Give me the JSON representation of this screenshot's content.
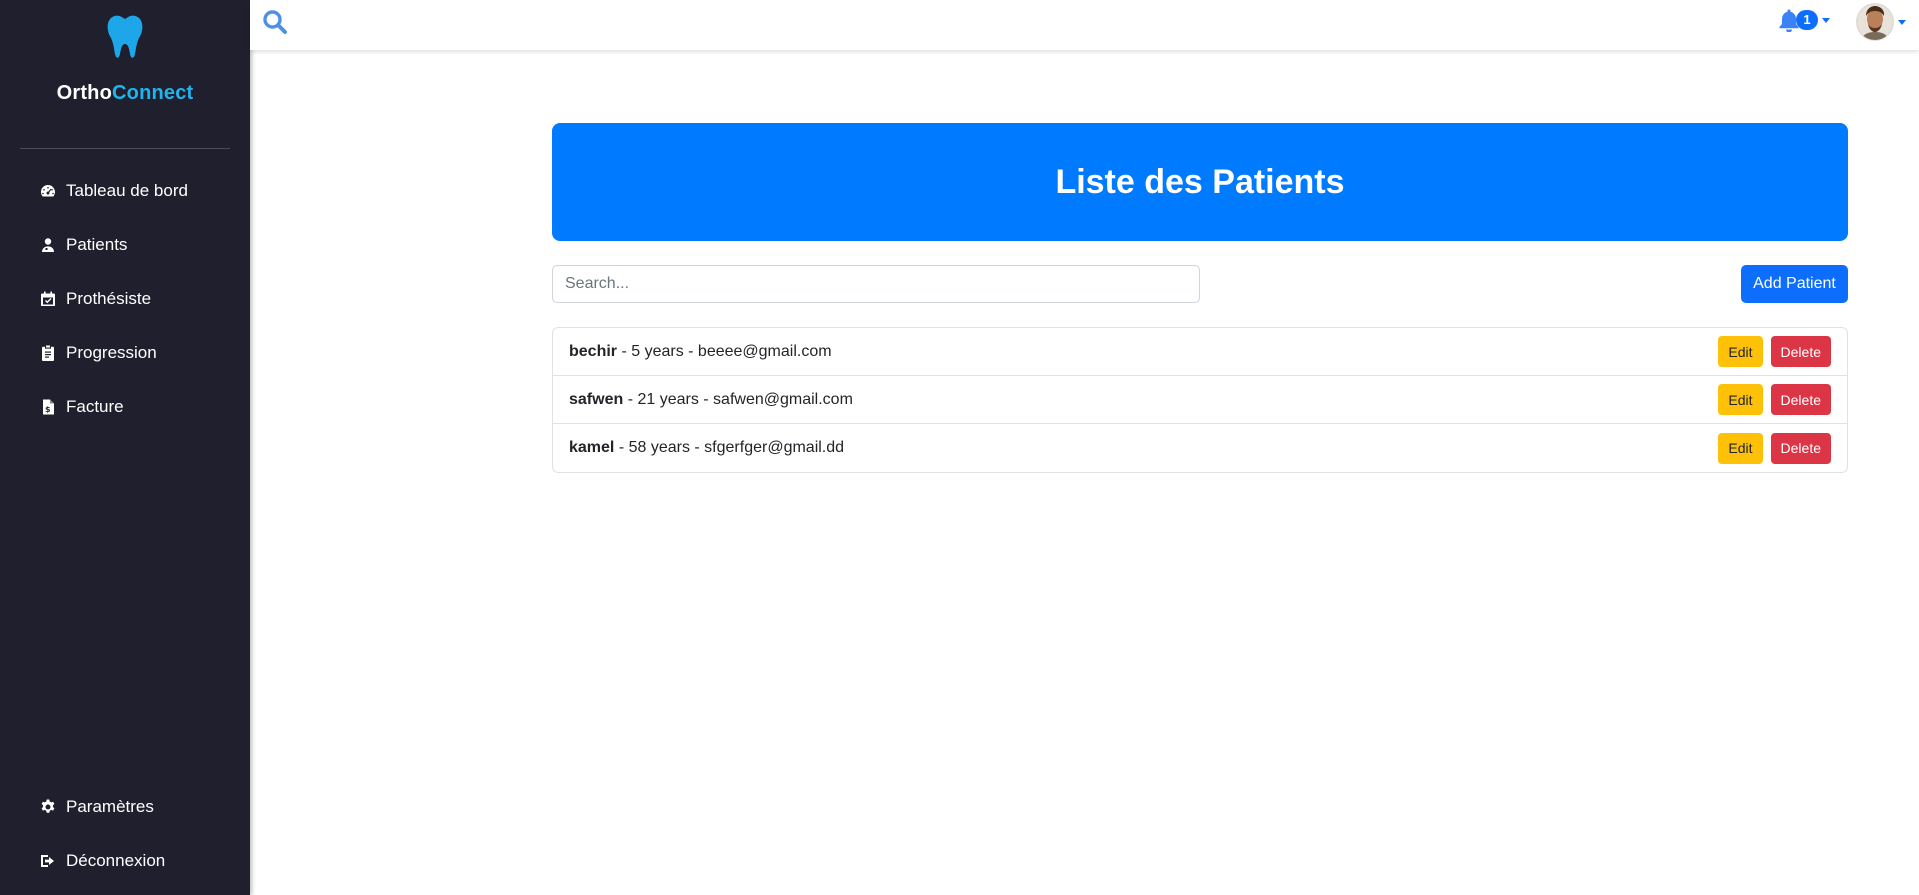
{
  "brand": {
    "part1": "Ortho",
    "part2": "Connect"
  },
  "sidebar": {
    "items": [
      {
        "label": "Tableau de bord",
        "icon": "tachometer-icon"
      },
      {
        "label": "Patients",
        "icon": "user-doctor-icon"
      },
      {
        "label": "Prothésiste",
        "icon": "calendar-check-icon"
      },
      {
        "label": "Progression",
        "icon": "clipboard-icon"
      },
      {
        "label": "Facture",
        "icon": "invoice-icon"
      }
    ],
    "bottom_items": [
      {
        "label": "Paramètres",
        "icon": "gear-icon"
      },
      {
        "label": "Déconnexion",
        "icon": "sign-out-icon"
      }
    ]
  },
  "topbar": {
    "notification_count": "1"
  },
  "main": {
    "title": "Liste des Patients",
    "search_placeholder": "Search...",
    "add_button": "Add Patient",
    "patients": [
      {
        "name": "bechir",
        "details": " - 5 years - beeee@gmail.com"
      },
      {
        "name": "safwen",
        "details": " - 21 years - safwen@gmail.com"
      },
      {
        "name": "kamel",
        "details": " - 58 years - sfgerfger@gmail.dd"
      }
    ],
    "edit_label": "Edit",
    "delete_label": "Delete"
  },
  "colors": {
    "sidebar_bg": "#1f1f2e",
    "accent": "#007bff",
    "brand_accent": "#1eb4f0",
    "edit": "#ffc107",
    "delete": "#dc3545"
  }
}
